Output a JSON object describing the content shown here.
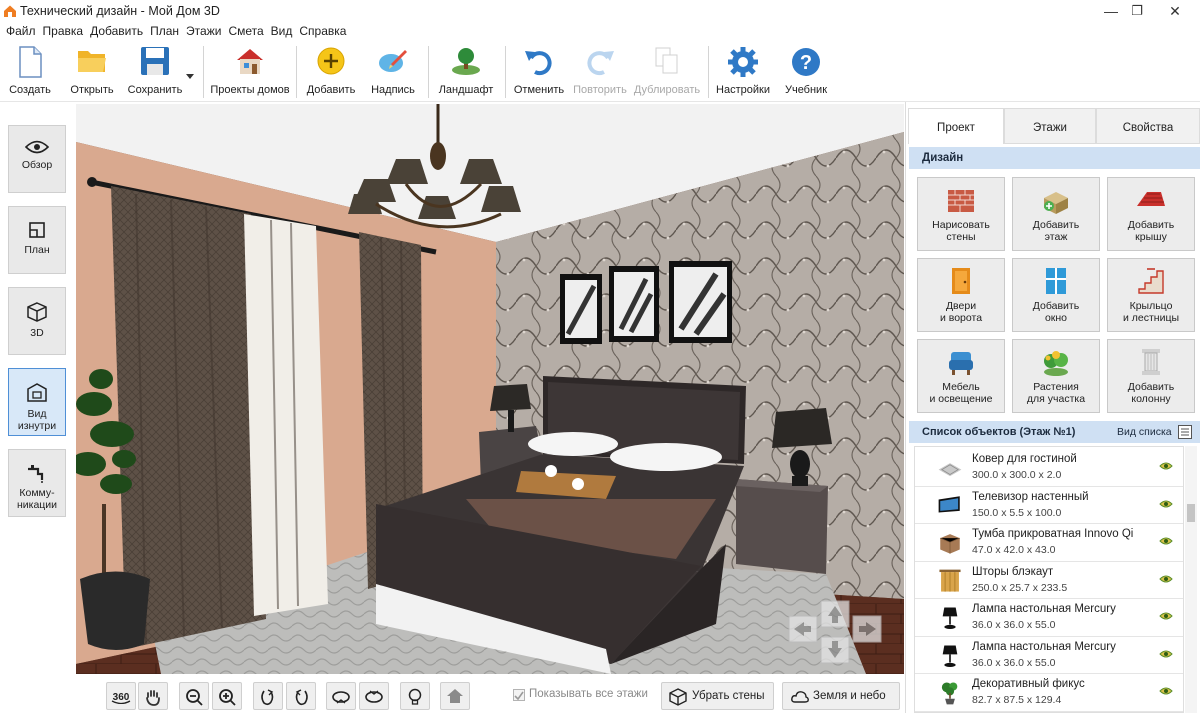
{
  "window": {
    "title": "Технический дизайн - Мой Дом 3D",
    "controls": [
      "—",
      "❐",
      "✕"
    ]
  },
  "menu": [
    "Файл",
    "Правка",
    "Добавить",
    "План",
    "Этажи",
    "Смета",
    "Вид",
    "Справка"
  ],
  "toolbar": {
    "create": "Создать",
    "open": "Открыть",
    "save": "Сохранить",
    "house_projects": "Проекты домов",
    "add": "Добавить",
    "label": "Надпись",
    "landscape": "Ландшафт",
    "undo": "Отменить",
    "redo": "Повторить",
    "duplicate": "Дублировать",
    "settings": "Настройки",
    "tutorial": "Учебник"
  },
  "views": {
    "overview": "Обзор",
    "plan": "План",
    "view3d": "3D",
    "inside_1": "Вид",
    "inside_2": "изнутри",
    "comm_1": "Комму-",
    "comm_2": "никации"
  },
  "bottom": {
    "rotate_label": "360",
    "show_all_floors": "Показывать все этажи",
    "remove_walls": "Убрать стены",
    "earth_sky": "Земля и небо"
  },
  "right": {
    "tabs": [
      "Проект",
      "Этажи",
      "Свойства"
    ],
    "design_header": "Дизайн",
    "design": [
      {
        "l1": "Нарисовать",
        "l2": "стены",
        "icon": "brick-wall-icon"
      },
      {
        "l1": "Добавить",
        "l2": "этаж",
        "icon": "add-floor-icon"
      },
      {
        "l1": "Добавить",
        "l2": "крышу",
        "icon": "roof-icon"
      },
      {
        "l1": "Двери",
        "l2": "и ворота",
        "icon": "door-icon"
      },
      {
        "l1": "Добавить",
        "l2": "окно",
        "icon": "window-icon"
      },
      {
        "l1": "Крыльцо",
        "l2": "и лестницы",
        "icon": "stairs-icon"
      },
      {
        "l1": "Мебель",
        "l2": "и освещение",
        "icon": "armchair-icon"
      },
      {
        "l1": "Растения",
        "l2": "для участка",
        "icon": "plants-icon"
      },
      {
        "l1": "Добавить",
        "l2": "колонну",
        "icon": "column-icon"
      }
    ],
    "objects_header": "Список объектов (Этаж №1)",
    "list_view": "Вид списка",
    "objects": [
      {
        "name": "Ковер для гостиной",
        "dims": "300.0 x 300.0 x 2.0",
        "icon": "carpet-icon"
      },
      {
        "name": "Телевизор настенный",
        "dims": "150.0 x 5.5 x 100.0",
        "icon": "tv-icon"
      },
      {
        "name": "Тумба прикроватная Innovo Qi",
        "dims": "47.0 x 42.0 x 43.0",
        "icon": "nightstand-icon"
      },
      {
        "name": "Шторы блэкаут",
        "dims": "250.0 x 25.7 x 233.5",
        "icon": "curtains-icon"
      },
      {
        "name": "Лампа настольная Mercury",
        "dims": "36.0 x 36.0 x 55.0",
        "icon": "lamp-icon"
      },
      {
        "name": "Лампа настольная Mercury",
        "dims": "36.0 x 36.0 x 55.0",
        "icon": "lamp-icon"
      },
      {
        "name": "Декоративный фикус",
        "dims": "82.7 x 87.5 x 129.4",
        "icon": "ficus-icon"
      }
    ]
  },
  "colors": {
    "accent": "#4f8fd6",
    "section_header": "#cfe0f3",
    "wall_left": "#d9a98f",
    "wallpaper": "#9f9790",
    "bed": "#3e3737",
    "floor": "#5a2f22"
  }
}
